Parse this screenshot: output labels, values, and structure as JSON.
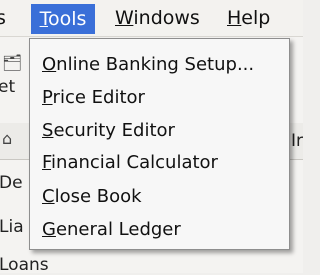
{
  "menubar": {
    "clipped_item": {
      "label": "s"
    },
    "tools": {
      "label_first": "T",
      "label_rest": "ools"
    },
    "windows": {
      "label_first": "W",
      "label_rest": "indows"
    },
    "help": {
      "label_first": "H",
      "label_rest": "elp"
    }
  },
  "tools_menu": {
    "items": [
      {
        "mnemonic": "O",
        "rest": "nline Banking Setup..."
      },
      {
        "mnemonic": "P",
        "rest": "rice Editor"
      },
      {
        "mnemonic": "S",
        "rest": "ecurity Editor"
      },
      {
        "mnemonic": "F",
        "rest": "inancial Calculator"
      },
      {
        "mnemonic": "C",
        "rest": "lose Book"
      },
      {
        "mnemonic": "G",
        "rest": "eneral Ledger"
      }
    ]
  },
  "background": {
    "fragments": [
      "et",
      "Ir",
      "De",
      "Lia",
      "Loans"
    ]
  },
  "colors": {
    "highlight": "#3a6fd8",
    "menu_background": "#f7f7f7",
    "menu_border": "#8e8e8e"
  },
  "icons": [
    "folder-icon",
    "home-icon"
  ]
}
